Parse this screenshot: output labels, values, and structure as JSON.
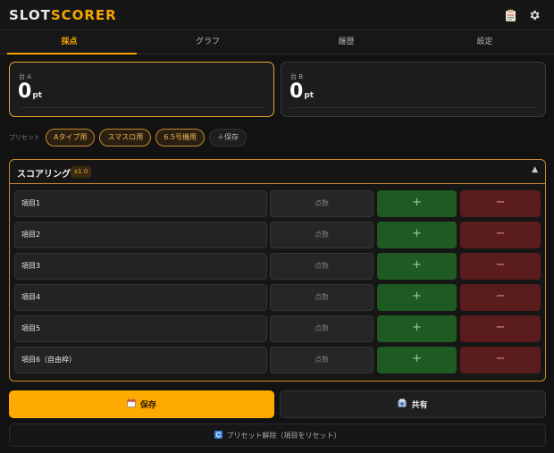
{
  "header": {
    "brand_part1": "SLOT",
    "brand_part2": "SCORER",
    "clipboard_icon": "clipboard-icon",
    "settings_icon": "gear-icon"
  },
  "tabs": [
    {
      "label": "採点",
      "active": true
    },
    {
      "label": "グラフ"
    },
    {
      "label": "履歴"
    },
    {
      "label": "設定"
    }
  ],
  "scores": {
    "a": {
      "label": "台 A",
      "value": "0",
      "unit": "pt"
    },
    "b": {
      "label": "台 B",
      "value": "0",
      "unit": "pt"
    }
  },
  "presets": {
    "label": "プリセット",
    "chips": [
      "Aタイプ用",
      "スマスロ用",
      "6.5号機用"
    ],
    "save_label": "＋保存"
  },
  "scoring": {
    "title": "スコアリング",
    "multiplier": "x1.0",
    "collapse_glyph": "▲",
    "points_placeholder": "点数",
    "plus_label": "+",
    "minus_label": "−",
    "items": [
      "項目1",
      "項目2",
      "項目3",
      "項目4",
      "項目5",
      "項目6（自由枠）"
    ]
  },
  "actions": {
    "save_label": "保存",
    "share_label": "共有",
    "reset_label": "プリセット解除（項目をリセット）"
  },
  "colors": {
    "accent": "#f5a400",
    "plus": "#1f5a22",
    "minus": "#5a1c1c"
  }
}
